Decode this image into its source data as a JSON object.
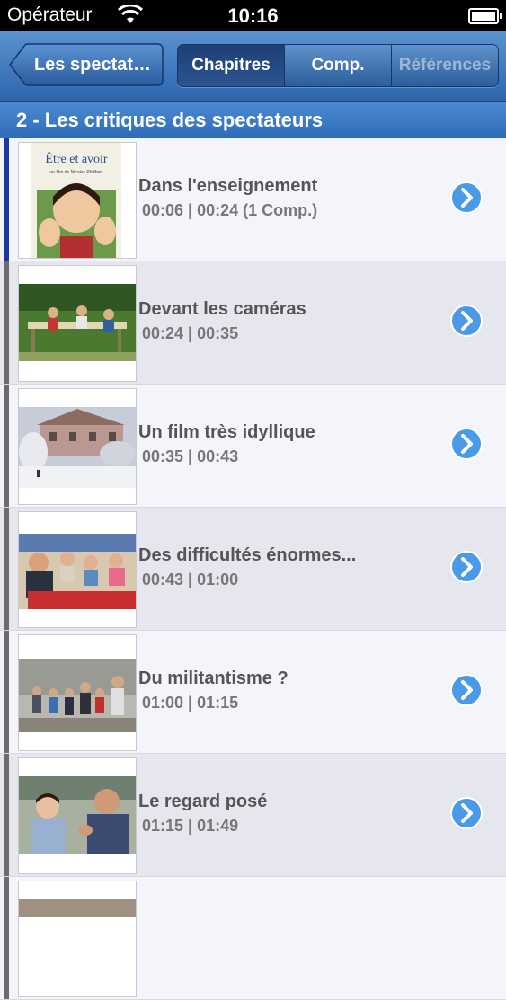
{
  "status_bar": {
    "carrier": "Opérateur",
    "time": "10:16"
  },
  "nav": {
    "back_label": "Les spectat…",
    "segments": [
      {
        "label": "Chapitres",
        "state": "selected"
      },
      {
        "label": "Comp.",
        "state": "normal"
      },
      {
        "label": "Références",
        "state": "disabled"
      }
    ]
  },
  "section": {
    "title": "2 - Les critiques des spectateurs"
  },
  "chapters": [
    {
      "title": "Dans l'enseignement",
      "meta": "00:06   |   00:24   (1 Comp.)",
      "thumb_text_1": "Être et avoir",
      "thumb_text_2": "un film de Nicolas Philibert"
    },
    {
      "title": "Devant les caméras",
      "meta": "00:24   |   00:35"
    },
    {
      "title": "Un film très idyllique",
      "meta": "00:35   |   00:43"
    },
    {
      "title": "Des difficultés énormes...",
      "meta": "00:43   |   01:00"
    },
    {
      "title": "Du militantisme ?",
      "meta": "01:00   |   01:15"
    },
    {
      "title": "Le regard posé",
      "meta": "01:15   |   01:49"
    },
    {
      "title": "",
      "meta": ""
    }
  ],
  "colors": {
    "active_bar": "#1a39a6",
    "inactive_bar": "#6b6b6b",
    "header_blue": "#2e6cb8",
    "disclosure": "#4a9ae8"
  }
}
